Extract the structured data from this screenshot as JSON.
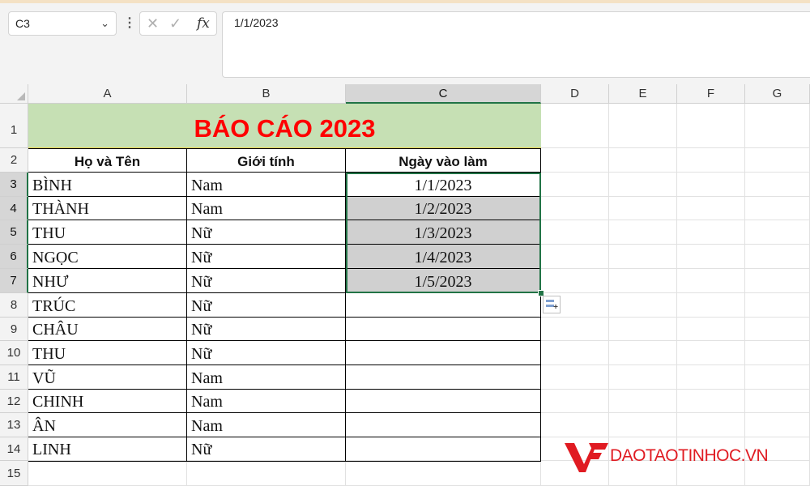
{
  "formula_bar": {
    "name_box": "C3",
    "fx_label": "fx",
    "formula_value": "1/1/2023"
  },
  "columns": [
    "A",
    "B",
    "C",
    "D",
    "E",
    "F",
    "G"
  ],
  "selected_column": "C",
  "rows": [
    "1",
    "2",
    "3",
    "4",
    "5",
    "6",
    "7",
    "8",
    "9",
    "10",
    "11",
    "12",
    "13",
    "14",
    "15"
  ],
  "sheet": {
    "title": "BÁO CÁO 2023",
    "headers": [
      "Họ và Tên",
      "Giới tính",
      "Ngày vào làm"
    ],
    "records": [
      {
        "name": "BÌNH",
        "gender": "Nam",
        "date": "1/1/2023"
      },
      {
        "name": "THÀNH",
        "gender": "Nam",
        "date": "1/2/2023"
      },
      {
        "name": "THU",
        "gender": "Nữ",
        "date": "1/3/2023"
      },
      {
        "name": "NGỌC",
        "gender": "Nữ",
        "date": "1/4/2023"
      },
      {
        "name": "NHƯ",
        "gender": "Nữ",
        "date": "1/5/2023"
      },
      {
        "name": "TRÚC",
        "gender": "Nữ",
        "date": ""
      },
      {
        "name": "CHÂU",
        "gender": "Nữ",
        "date": ""
      },
      {
        "name": "THU",
        "gender": "Nữ",
        "date": ""
      },
      {
        "name": "VŨ",
        "gender": "Nam",
        "date": ""
      },
      {
        "name": "CHINH",
        "gender": "Nam",
        "date": ""
      },
      {
        "name": "ÂN",
        "gender": "Nam",
        "date": ""
      },
      {
        "name": "LINH",
        "gender": "Nữ",
        "date": ""
      }
    ]
  },
  "watermark": {
    "text": "DAOTAOTINHOC.VN",
    "color": "#e01b22"
  },
  "colors": {
    "accent": "#217346",
    "title_fill": "#c6e0b4",
    "title_text": "#ff0000",
    "selection_fill": "#d0d0d0"
  }
}
